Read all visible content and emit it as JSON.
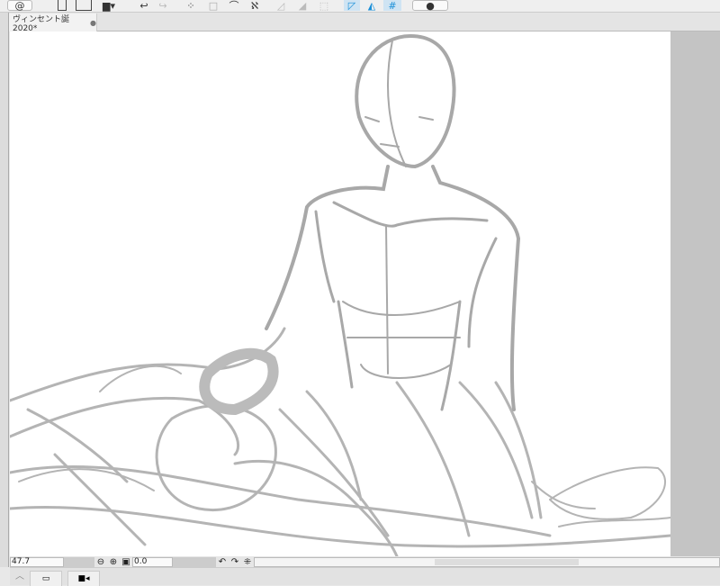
{
  "toolbar": {
    "icons": [
      "app-logo-icon",
      "new-file-icon",
      "open-file-icon",
      "save-icon",
      "undo-icon",
      "redo-icon",
      "select-icon",
      "selection-icon",
      "lasso-icon",
      "transform-icon",
      "clear-icon",
      "fill-icon",
      "deselect-icon",
      "ruler-snap-icon",
      "special-ruler-icon",
      "grid-snap-icon",
      "help-icon"
    ]
  },
  "tab": {
    "title": "ヴィンセント誕2020*"
  },
  "status": {
    "zoom": "47.7",
    "rotation": "0.0"
  },
  "colors": {
    "stroke": "#a8a8a8",
    "accent": "#1a8fd8"
  }
}
